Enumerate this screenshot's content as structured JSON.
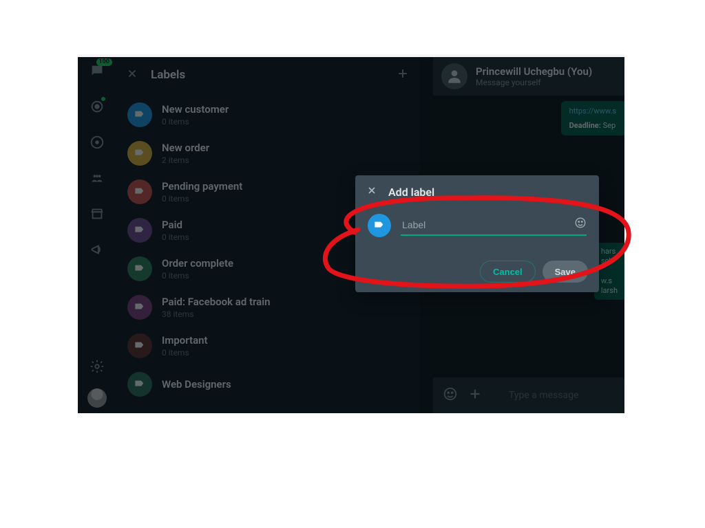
{
  "nav": {
    "badge_count": "100"
  },
  "labels_panel": {
    "title": "Labels",
    "items": [
      {
        "name": "New customer",
        "count": "0 items",
        "color": "#1f97e0"
      },
      {
        "name": "New order",
        "count": "2 items",
        "color": "#d9b23d"
      },
      {
        "name": "Pending payment",
        "count": "0 items",
        "color": "#c84f4f"
      },
      {
        "name": "Paid",
        "count": "0 items",
        "color": "#6f4a8e"
      },
      {
        "name": "Order complete",
        "count": "0 items",
        "color": "#2e7d5b"
      },
      {
        "name": "Paid: Facebook ad train",
        "count": "38 items",
        "color": "#7a3f7a"
      },
      {
        "name": "Important",
        "count": "0 items",
        "color": "#5e2f2f"
      },
      {
        "name": "Web Designers",
        "count": "",
        "color": "#2e6f5b"
      }
    ]
  },
  "chat": {
    "title": "Princewill Uchegbu (You)",
    "subtitle": "Message yourself",
    "bubble": {
      "link_text": "https://www.s",
      "deadline_label": "Deadline:",
      "deadline_value": "Sep"
    },
    "bubble2": {
      "t1": "hars",
      "t2": "sch",
      "t3": "w.s",
      "t4": "larsh"
    },
    "compose_placeholder": "Type a message"
  },
  "modal": {
    "title": "Add label",
    "placeholder": "Label",
    "cancel": "Cancel",
    "save": "Save",
    "color": "#1f97e0"
  }
}
